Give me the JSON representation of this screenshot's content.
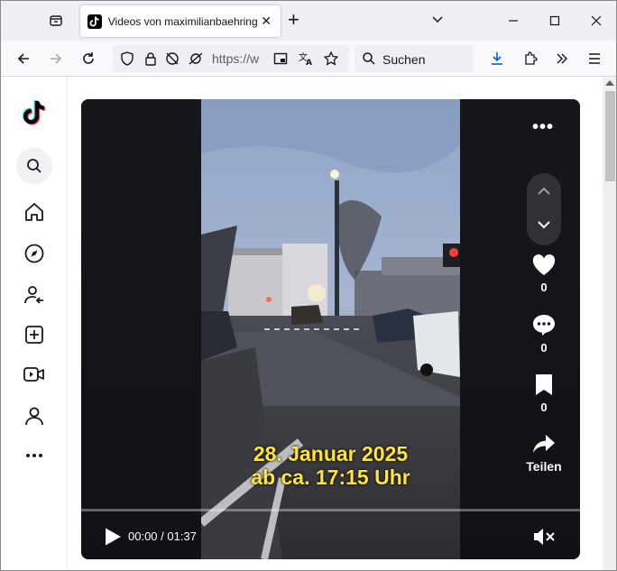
{
  "browser": {
    "tab_title": "Videos von maximilianbaehring",
    "url": "https://w",
    "search_placeholder": "Suchen"
  },
  "video": {
    "caption_line1": "28. Januar 2025",
    "caption_line2": "ab ca. 17:15 Uhr",
    "time": "00:00 / 01:37",
    "progress": 0
  },
  "actions": {
    "likes": "0",
    "comments": "0",
    "saves": "0",
    "share_label": "Teilen"
  },
  "colors": {
    "caption": "#ffe53b",
    "accent": "#fe2c55",
    "tiktok_cyan": "#25f4ee"
  },
  "icons": [
    "tab-list-icon",
    "tiktok-favicon",
    "close-icon",
    "plus-icon",
    "chevron-down-icon",
    "minimize-icon",
    "maximize-icon",
    "close-window-icon",
    "back-icon",
    "forward-icon",
    "reload-icon",
    "shield-icon",
    "lock-icon",
    "tracking-icon",
    "reader-icon",
    "translate-icon",
    "star-icon",
    "search-icon",
    "download-icon",
    "extensions-icon",
    "overflow-icon",
    "menu-icon",
    "tiktok-logo",
    "home-icon",
    "explore-icon",
    "following-icon",
    "upload-icon",
    "live-icon",
    "profile-icon",
    "more-icon",
    "heart-icon",
    "comment-icon",
    "bookmark-icon",
    "share-icon",
    "play-icon",
    "mute-icon",
    "chevron-up-icon"
  ]
}
